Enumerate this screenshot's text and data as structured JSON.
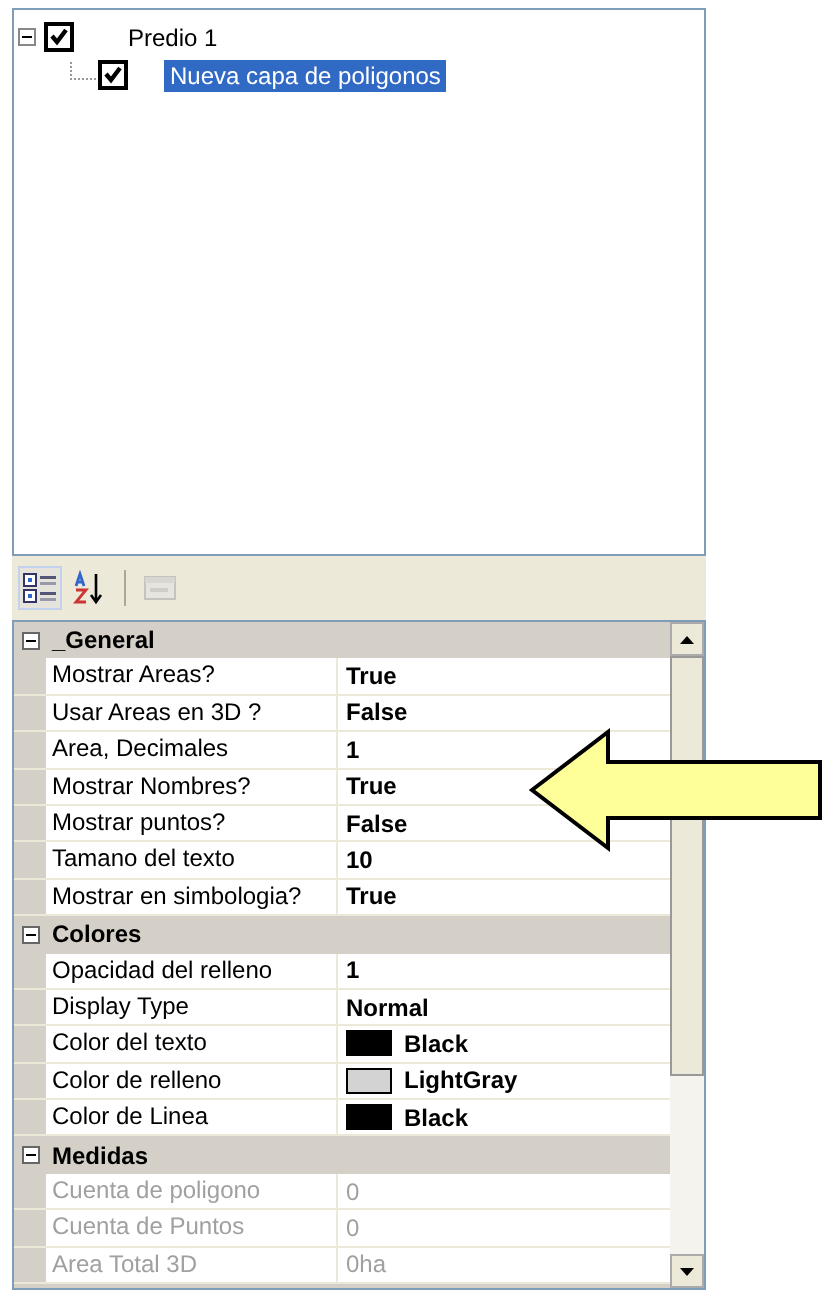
{
  "tree": [
    {
      "label": "Predio 1",
      "checked": true,
      "expanded": true,
      "selected": false,
      "children": [
        {
          "label": "Nueva capa de poligonos",
          "checked": true,
          "selected": true
        }
      ]
    }
  ],
  "toolbar": [
    {
      "kind": "categorized",
      "selected": true,
      "disabled": false
    },
    {
      "kind": "alphabetical",
      "selected": false,
      "disabled": false
    },
    {
      "kind": "pages",
      "selected": false,
      "disabled": true
    }
  ],
  "categories": [
    {
      "name": "_General",
      "expanded": true,
      "properties": [
        {
          "label": "Mostrar Areas?",
          "value": "True",
          "disabled": false
        },
        {
          "label": "Usar Areas en 3D ?",
          "value": "False",
          "disabled": false
        },
        {
          "label": "Area, Decimales",
          "value": "1",
          "disabled": false
        },
        {
          "label": "Mostrar Nombres?",
          "value": "True",
          "disabled": false
        },
        {
          "label": "Mostrar puntos?",
          "value": "False",
          "disabled": false
        },
        {
          "label": "Tamano del texto",
          "value": "10",
          "disabled": false
        },
        {
          "label": "Mostrar en simbologia?",
          "value": "True",
          "disabled": false
        }
      ]
    },
    {
      "name": "Colores",
      "expanded": true,
      "properties": [
        {
          "label": "Opacidad del relleno",
          "value": "1",
          "disabled": false
        },
        {
          "label": "Display Type",
          "value": "Normal",
          "disabled": false
        },
        {
          "label": "Color del texto",
          "value": "Black",
          "color": "#000000",
          "disabled": false
        },
        {
          "label": "Color de relleno",
          "value": "LightGray",
          "color": "#d3d3d3",
          "disabled": false
        },
        {
          "label": "Color de Linea",
          "value": "Black",
          "color": "#000000",
          "disabled": false
        }
      ]
    },
    {
      "name": "Medidas",
      "expanded": true,
      "properties": [
        {
          "label": "Cuenta de poligono",
          "value": "0",
          "disabled": true
        },
        {
          "label": "Cuenta de Puntos",
          "value": "0",
          "disabled": true
        },
        {
          "label": "Area Total 3D",
          "value": "0ha",
          "disabled": true
        }
      ]
    }
  ]
}
